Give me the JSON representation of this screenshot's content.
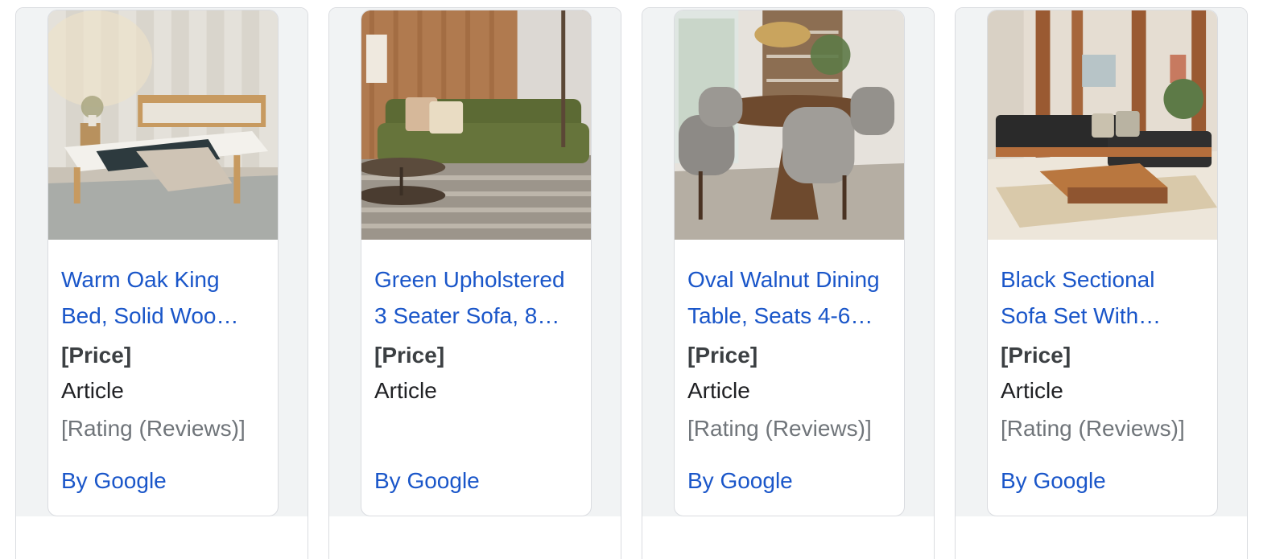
{
  "products": [
    {
      "title": "Warm Oak King Bed, Solid Woo…",
      "price": "[Price]",
      "source": "Article",
      "rating": "[Rating (Reviews)]",
      "byline": "By Google",
      "image": "oak-bed-photo"
    },
    {
      "title": "Green Upholstered 3 Seater Sofa, 8…",
      "price": "[Price]",
      "source": "Article",
      "rating": "",
      "byline": "By Google",
      "image": "green-sofa-photo"
    },
    {
      "title": "Oval Walnut Dining Table, Seats 4-6…",
      "price": "[Price]",
      "source": "Article",
      "rating": "[Rating (Reviews)]",
      "byline": "By Google",
      "image": "dining-table-photo"
    },
    {
      "title": "Black Sectional Sofa Set With…",
      "price": "[Price]",
      "source": "Article",
      "rating": "[Rating (Reviews)]",
      "byline": "By Google",
      "image": "sectional-sofa-photo"
    }
  ],
  "colors": {
    "link": "#1a56c9",
    "price": "#3c4043",
    "muted": "#70757a",
    "band": "#f1f3f4",
    "border": "#dadce0"
  }
}
